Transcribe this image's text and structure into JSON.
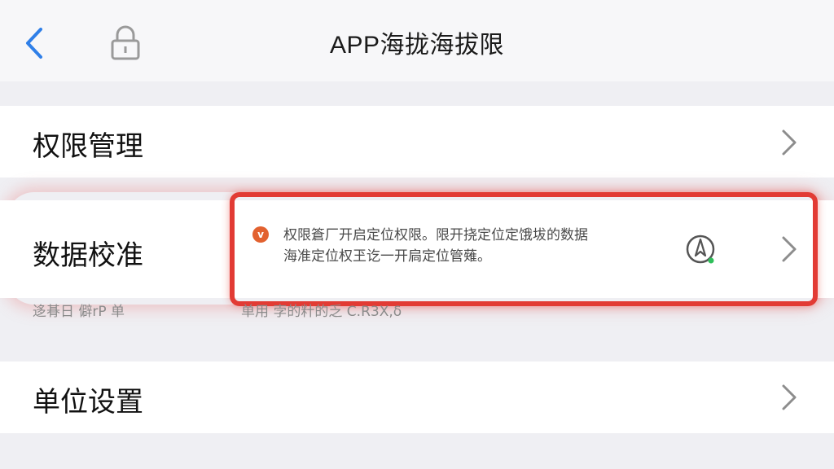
{
  "navbar": {
    "title": "APP海拢海拔限",
    "back_icon": "chevron-left-icon",
    "lock_icon": "lock-icon",
    "accent": "#2f7fe8"
  },
  "rows": {
    "permissions": {
      "label": "权限管理"
    },
    "calibration": {
      "label": "数据校准",
      "notice_line1": "权限篬厂开启定位权限。限开挠定位定饿坺的数据",
      "notice_line2": "海准定位权玊讫一开扃定位管薙。",
      "notice_icon_text": "v",
      "subtext_left": "迻朞日 僻rP 单",
      "subtext_mid": "单用 孛的籵的乏 C.R3X,δ",
      "highlight_color": "#e23b34"
    },
    "units": {
      "label": "单位设置"
    }
  }
}
